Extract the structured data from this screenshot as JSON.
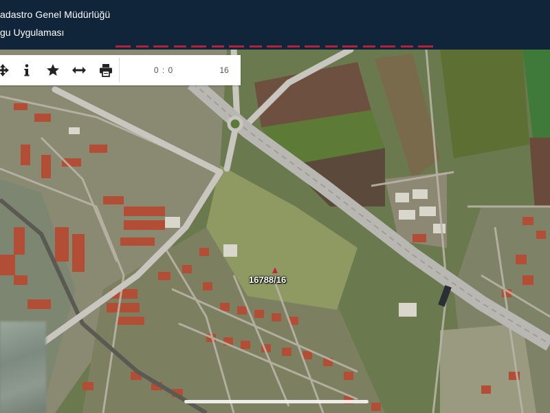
{
  "header": {
    "title": "adastro Genel Müdürlüğü",
    "subtitle": "gu Uygulaması",
    "bg_color": "#10243a",
    "accent_color": "#d2213a"
  },
  "toolbar": {
    "buttons": [
      {
        "name": "navigate",
        "icon": "navigate-arrows-icon"
      },
      {
        "name": "info",
        "icon": "info-icon"
      },
      {
        "name": "favorites",
        "icon": "star-icon"
      },
      {
        "name": "measure",
        "icon": "horizontal-arrows-icon"
      },
      {
        "name": "print",
        "icon": "printer-icon"
      }
    ],
    "coordinate": "0 : 0",
    "zoom": "16"
  },
  "map": {
    "parcel_label": "16788/16",
    "marker_color": "#c2273d"
  }
}
